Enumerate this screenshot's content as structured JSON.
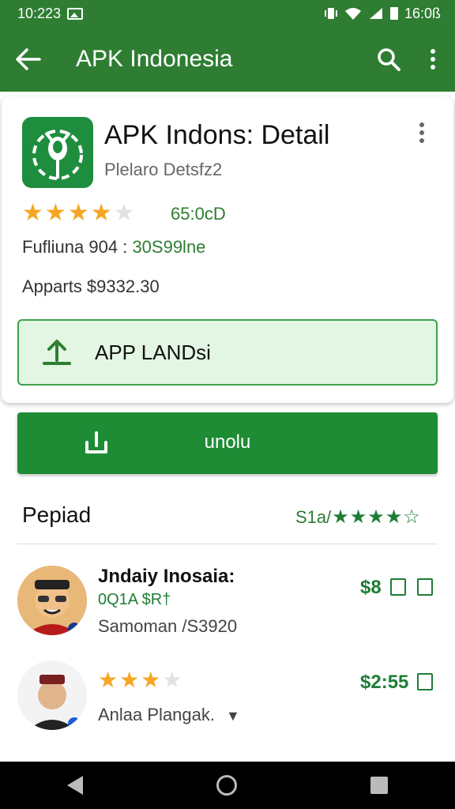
{
  "status_bar": {
    "time": "10:223",
    "clock_right": "16:0ß"
  },
  "app_bar": {
    "title": "APK Indonesia"
  },
  "detail": {
    "app_name": "APK Indons: Detail",
    "subtitle": "Plelaro Detsfz2",
    "rating_value": 3.5,
    "rating_text": "65:0cD",
    "fulfill_label": "Fufliuna 904 : ",
    "fulfill_value": "30S99lne",
    "apparts": "Apparts $9332.30",
    "landsi_button": "APP LANDsi"
  },
  "main_button": {
    "label": "unolu"
  },
  "section": {
    "title": "Pepiad",
    "rating_prefix": "S1a/",
    "rating_stars": 4
  },
  "list": [
    {
      "title": "Jndaiy Inosaia:",
      "subtitle": "0Q1A $R†",
      "meta": "Samoman /S3920",
      "price": "$8"
    },
    {
      "stars": 2.5,
      "meta": "Anlaa Plangak.",
      "price": "$2:55"
    }
  ],
  "colors": {
    "primary": "#2e7d32",
    "accent_star": "#f5a623",
    "landsi_bg": "#e3f6e3"
  }
}
